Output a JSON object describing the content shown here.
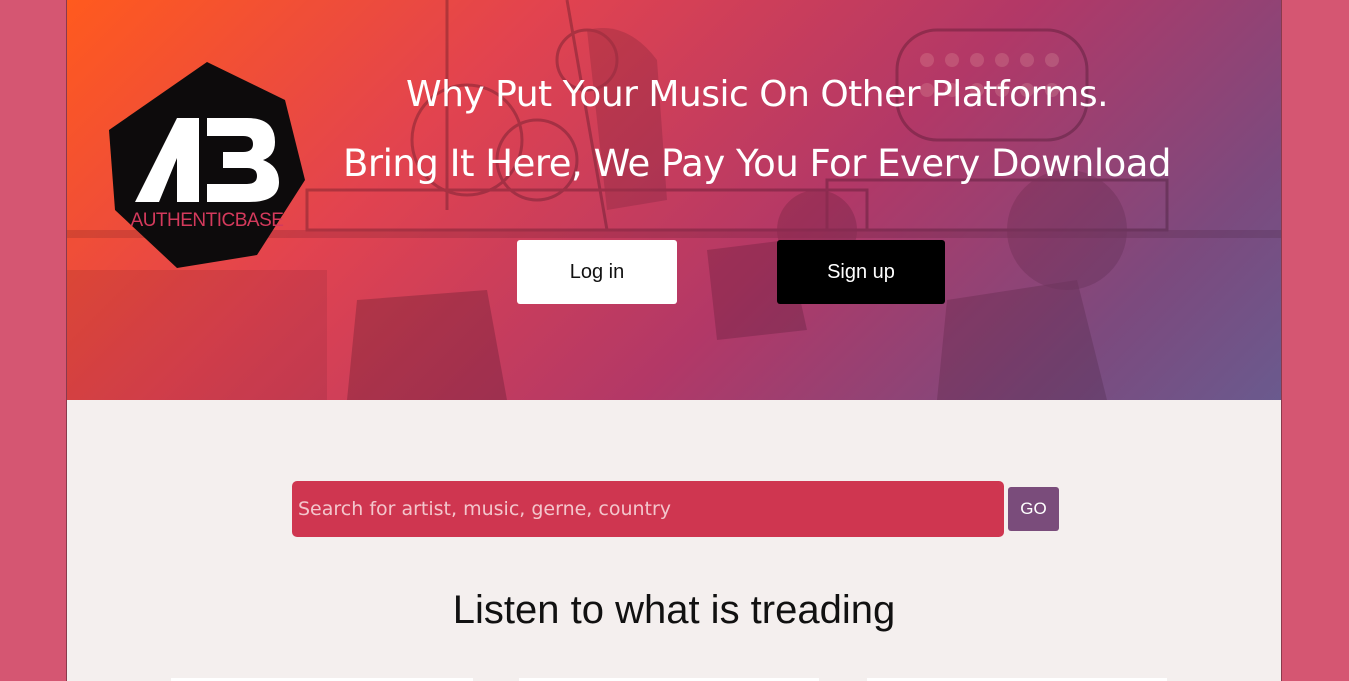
{
  "hero": {
    "line1": "Why Put Your Music On Other Platforms.",
    "line2": "Bring It Here, We Pay You For Every Download",
    "gradient_colors": [
      "#ff5a1e",
      "#e2434f",
      "#b23867",
      "#7c4a7e",
      "#6a5a8e"
    ]
  },
  "logo": {
    "monogram": "AB",
    "wordmark": "AUTHENTICBASE",
    "icon": "hexagon-logo"
  },
  "auth": {
    "login_label": "Log in",
    "signup_label": "Sign up"
  },
  "search": {
    "placeholder": "Search for artist, music, gerne, country",
    "value": "",
    "go_label": "GO",
    "accent": "#cf3650",
    "go_color": "#7a4c7b"
  },
  "trending": {
    "title": "Listen to what is treading"
  },
  "colors": {
    "outer_background": "#d55672",
    "content_background": "#f4efee"
  }
}
